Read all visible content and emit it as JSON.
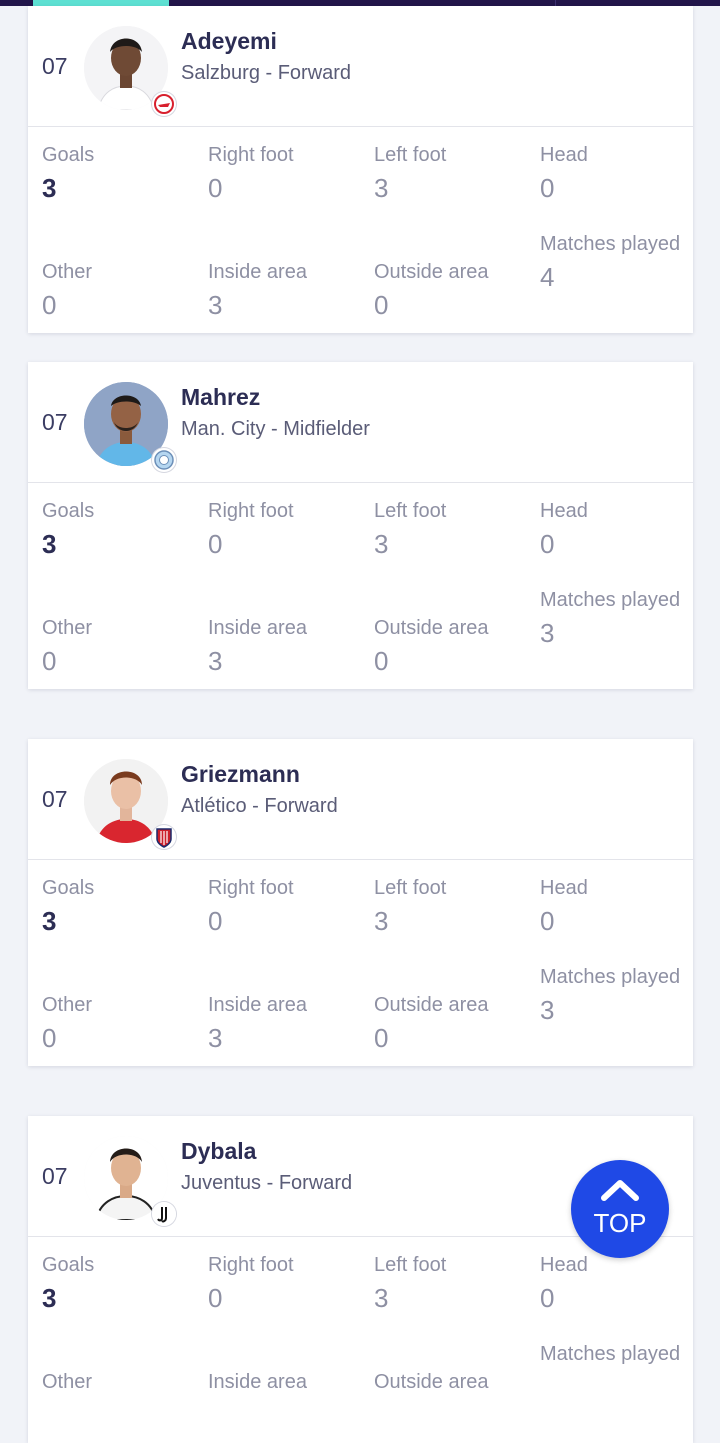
{
  "colors": {
    "accent": "#5ee0d2",
    "header_bg": "#22154a",
    "primary_text": "#2c2d54",
    "button": "#1f49e6"
  },
  "stat_labels": {
    "goals": "Goals",
    "right_foot": "Right foot",
    "left_foot": "Left foot",
    "head": "Head",
    "other": "Other",
    "inside_area": "Inside area",
    "outside_area": "Outside area",
    "matches_played": "Matches played"
  },
  "players": [
    {
      "rank": "07",
      "name": "Adeyemi",
      "club": "Salzburg - Forward",
      "club_icon": "salzburg-crest-icon",
      "goals": "3",
      "right_foot": "0",
      "left_foot": "3",
      "head": "0",
      "other": "0",
      "inside_area": "3",
      "outside_area": "0",
      "matches_played": "4"
    },
    {
      "rank": "07",
      "name": "Mahrez",
      "club": "Man. City - Midfielder",
      "club_icon": "man-city-crest-icon",
      "goals": "3",
      "right_foot": "0",
      "left_foot": "3",
      "head": "0",
      "other": "0",
      "inside_area": "3",
      "outside_area": "0",
      "matches_played": "3"
    },
    {
      "rank": "07",
      "name": "Griezmann",
      "club": "Atlético - Forward",
      "club_icon": "atletico-crest-icon",
      "goals": "3",
      "right_foot": "0",
      "left_foot": "3",
      "head": "0",
      "other": "0",
      "inside_area": "3",
      "outside_area": "0",
      "matches_played": "3"
    },
    {
      "rank": "07",
      "name": "Dybala",
      "club": "Juventus - Forward",
      "club_icon": "juventus-crest-icon",
      "goals": "3",
      "right_foot": "0",
      "left_foot": "3",
      "head": "0",
      "other": "",
      "inside_area": "",
      "outside_area": "",
      "matches_played": ""
    }
  ],
  "top_button": {
    "label": "TOP",
    "icon": "chevron-up-icon"
  }
}
